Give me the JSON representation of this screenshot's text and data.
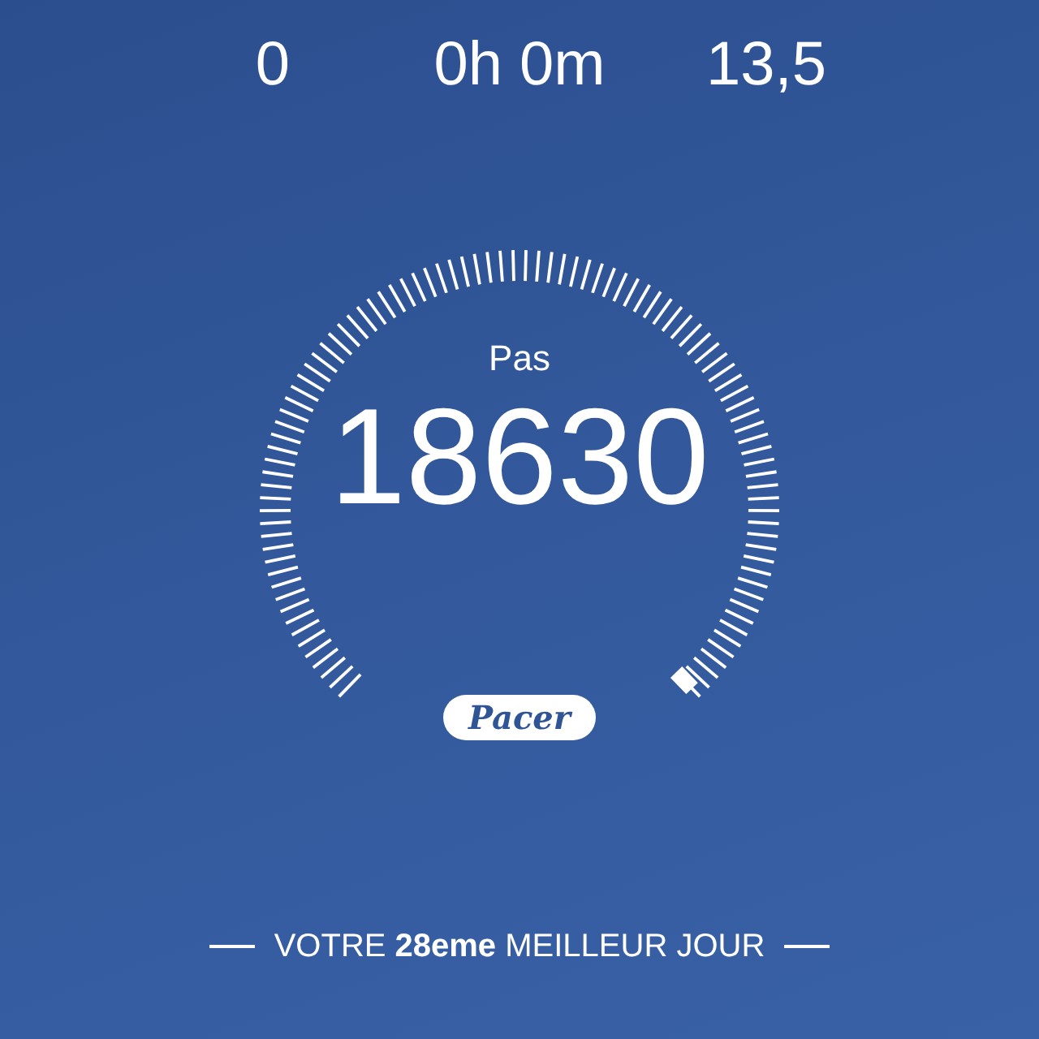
{
  "stats": [
    {
      "value": "0"
    },
    {
      "value": "0h 0m"
    },
    {
      "value": "13,5"
    }
  ],
  "gauge": {
    "label": "Pas",
    "value": "18630"
  },
  "logo": "Pacer",
  "footer": "VOTRE **28eme** MEILLEUR JOUR"
}
